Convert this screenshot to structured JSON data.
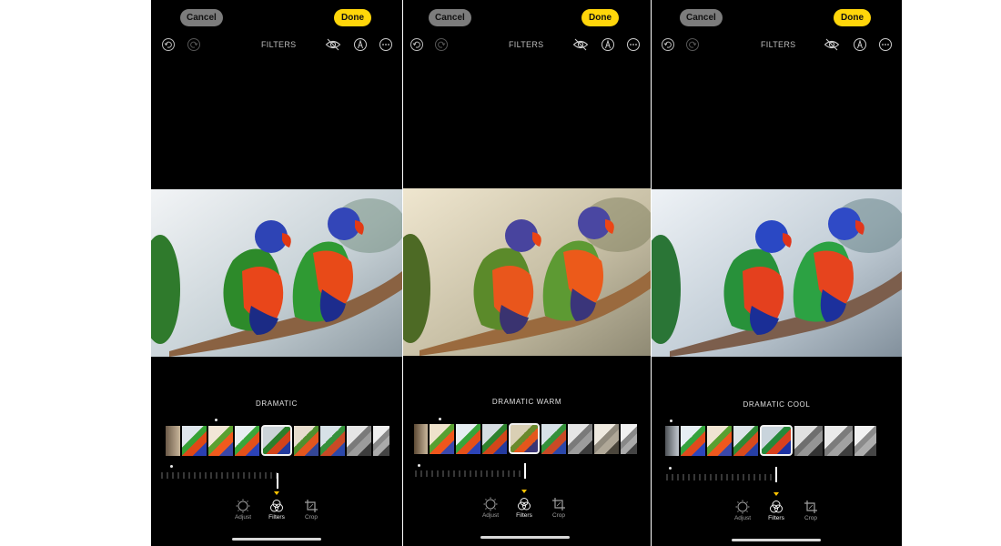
{
  "panels": [
    {
      "cancel_label": "Cancel",
      "done_label": "Done",
      "title": "FILTERS",
      "filter_name": "DRAMATIC",
      "variant": "dramatic",
      "tools": [
        "Adjust",
        "Filters",
        "Crop"
      ],
      "active_tool": "Filters"
    },
    {
      "cancel_label": "Cancel",
      "done_label": "Done",
      "title": "FILTERS",
      "filter_name": "DRAMATIC WARM",
      "variant": "warm",
      "tools": [
        "Adjust",
        "Filters",
        "Crop"
      ],
      "active_tool": "Filters"
    },
    {
      "cancel_label": "Cancel",
      "done_label": "Done",
      "title": "FILTERS",
      "filter_name": "DRAMATIC COOL",
      "variant": "cool",
      "tools": [
        "Adjust",
        "Filters",
        "Crop"
      ],
      "active_tool": "Filters"
    }
  ],
  "icons": {
    "toolbar_left": [
      "undo-icon",
      "redo-icon"
    ],
    "toolbar_right": [
      "hide-original-icon",
      "markup-icon",
      "more-options-icon"
    ],
    "tools": [
      "adjust-icon",
      "filters-icon",
      "crop-icon"
    ]
  },
  "colors": {
    "done_button": "#ffd60a",
    "cancel_button": "#7c7c7c",
    "active_indicator": "#ffc400",
    "background": "#000000"
  }
}
